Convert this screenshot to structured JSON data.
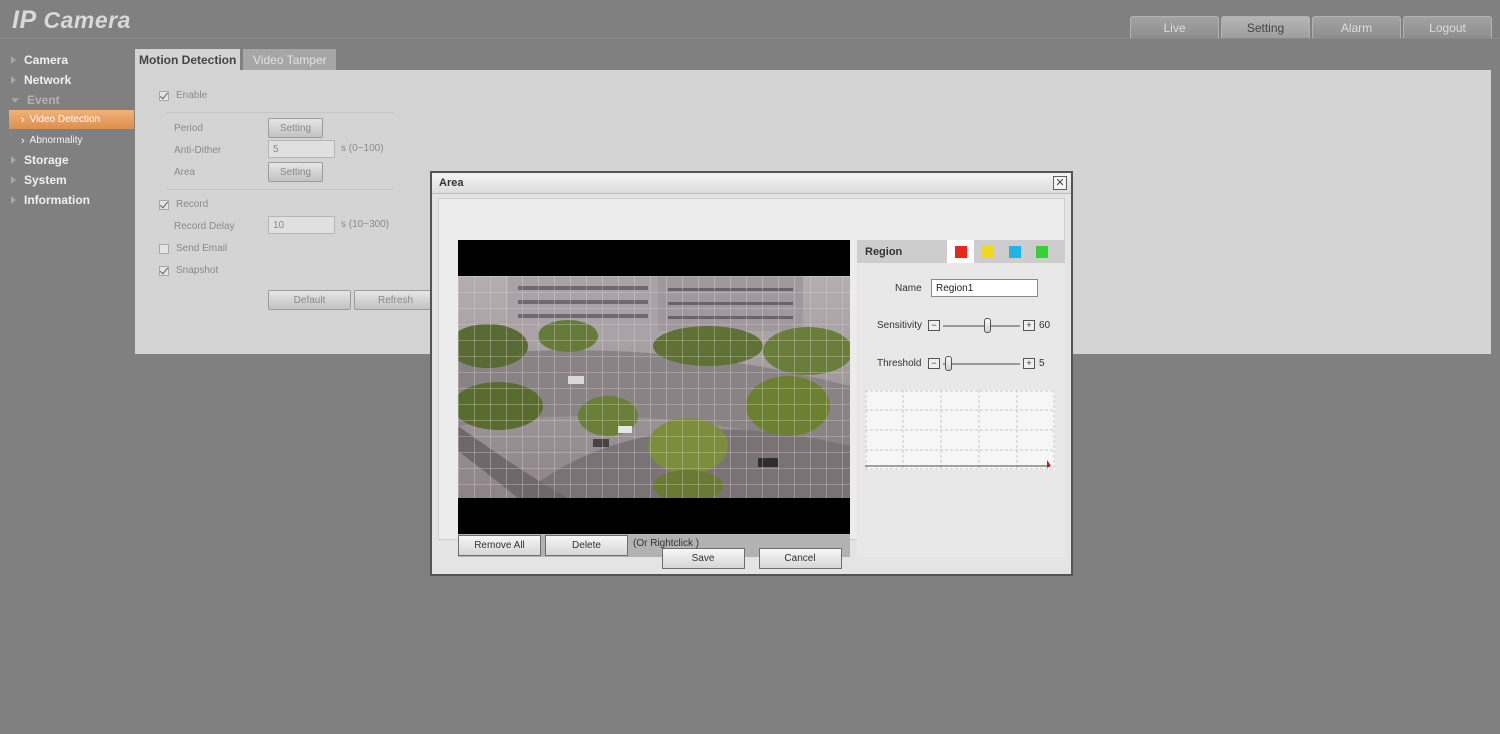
{
  "header": {
    "brand_ip": "IP",
    "brand_camera": "Camera",
    "tabs": [
      {
        "label": "Live"
      },
      {
        "label": "Setting"
      },
      {
        "label": "Alarm"
      },
      {
        "label": "Logout"
      }
    ],
    "active_tab": "Setting"
  },
  "sidebar": {
    "items": [
      {
        "label": "Camera"
      },
      {
        "label": "Network"
      },
      {
        "label": "Event"
      },
      {
        "label": "Video Detection"
      },
      {
        "label": "Abnormality"
      },
      {
        "label": "Storage"
      },
      {
        "label": "System"
      },
      {
        "label": "Information"
      }
    ],
    "active_item": "Video Detection"
  },
  "main": {
    "tabs": [
      {
        "label": "Motion Detection"
      },
      {
        "label": "Video Tamper"
      }
    ],
    "enable_label": "Enable",
    "enable_checked": true,
    "period_label": "Period",
    "period_button": "Setting",
    "anti_dither_label": "Anti-Dither",
    "anti_dither_value": "5",
    "anti_dither_unit": "s (0~100)",
    "area_label": "Area",
    "area_button": "Setting",
    "record_label": "Record",
    "record_checked": true,
    "record_delay_label": "Record Delay",
    "record_delay_value": "10",
    "record_delay_unit": "s (10~300)",
    "send_email_label": "Send Email",
    "send_email_checked": false,
    "snapshot_label": "Snapshot",
    "snapshot_checked": true,
    "default_button": "Default",
    "refresh_button": "Refresh"
  },
  "modal": {
    "title": "Area",
    "close_icon": "close-icon",
    "remove_all_button": "Remove All",
    "delete_button": "Delete",
    "hint": "(Or Rightclick )",
    "region": {
      "label": "Region",
      "colors": [
        "#e8281c",
        "#f2d81c",
        "#1cb6e8",
        "#34d034"
      ],
      "selected_color": "#e8281c",
      "name_label": "Name",
      "name_value": "Region1",
      "sensitivity_label": "Sensitivity",
      "sensitivity_value": "60",
      "threshold_label": "Threshold",
      "threshold_value": "5"
    },
    "save_button": "Save",
    "cancel_button": "Cancel"
  }
}
